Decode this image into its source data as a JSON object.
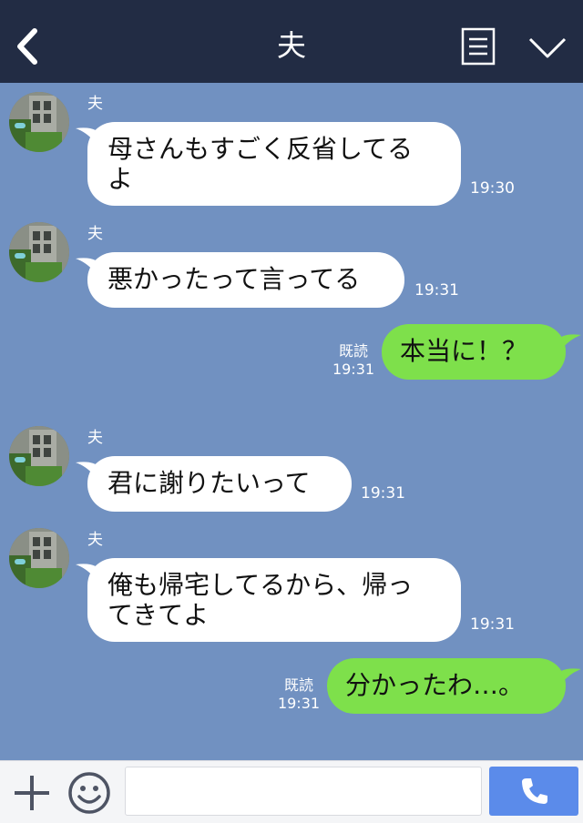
{
  "header": {
    "title": "夫",
    "icons": {
      "back": "chevron-left-icon",
      "menu": "notes-icon",
      "more": "chevron-down-icon"
    }
  },
  "messages": [
    {
      "side": "left",
      "sender": "夫",
      "text_lines": [
        "母さんもすごく反省してる",
        "よ"
      ],
      "time": "19:30"
    },
    {
      "side": "left",
      "sender": "夫",
      "text_lines": [
        "悪かったって言ってる"
      ],
      "time": "19:31"
    },
    {
      "side": "right",
      "read_label": "既読",
      "text_lines": [
        "本当に！？"
      ],
      "time": "19:31"
    },
    {
      "side": "left",
      "sender": "夫",
      "text_lines": [
        "君に謝りたいって"
      ],
      "time": "19:31"
    },
    {
      "side": "left",
      "sender": "夫",
      "text_lines": [
        "俺も帰宅してるから、帰っ",
        "てきてよ"
      ],
      "time": "19:31"
    },
    {
      "side": "right",
      "read_label": "既読",
      "text_lines": [
        "分かったわ…。"
      ],
      "time": "19:31"
    }
  ],
  "bottom_bar": {
    "input_value": "",
    "input_placeholder": "",
    "icons": {
      "add": "plus-icon",
      "sticker": "smile-icon",
      "call": "phone-icon"
    }
  },
  "colors": {
    "header_bg": "#222c44",
    "chat_bg": "#7191c1",
    "incoming_bubble": "#ffffff",
    "outgoing_bubble": "#7ee04b",
    "call_button": "#5b8bea"
  }
}
